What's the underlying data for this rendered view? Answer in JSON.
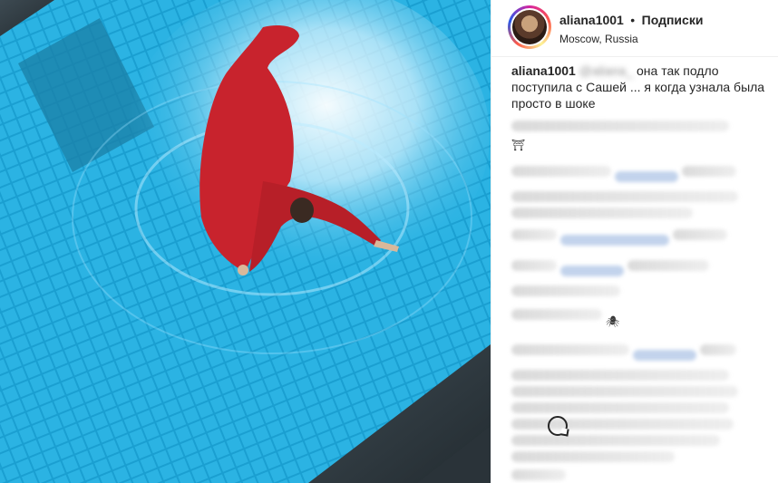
{
  "post": {
    "username": "aliana1001",
    "separator": "•",
    "follow_label": "Подписки",
    "location": "Moscow, Russia"
  },
  "caption": {
    "username": "aliana1001",
    "text": "она так подло поступила с Сашей ... я когда узнала была просто в шоке"
  },
  "comments": {
    "emoji_1": "⛩",
    "emoji_2": "🕷"
  },
  "icons": {
    "comment": "comment-icon"
  }
}
